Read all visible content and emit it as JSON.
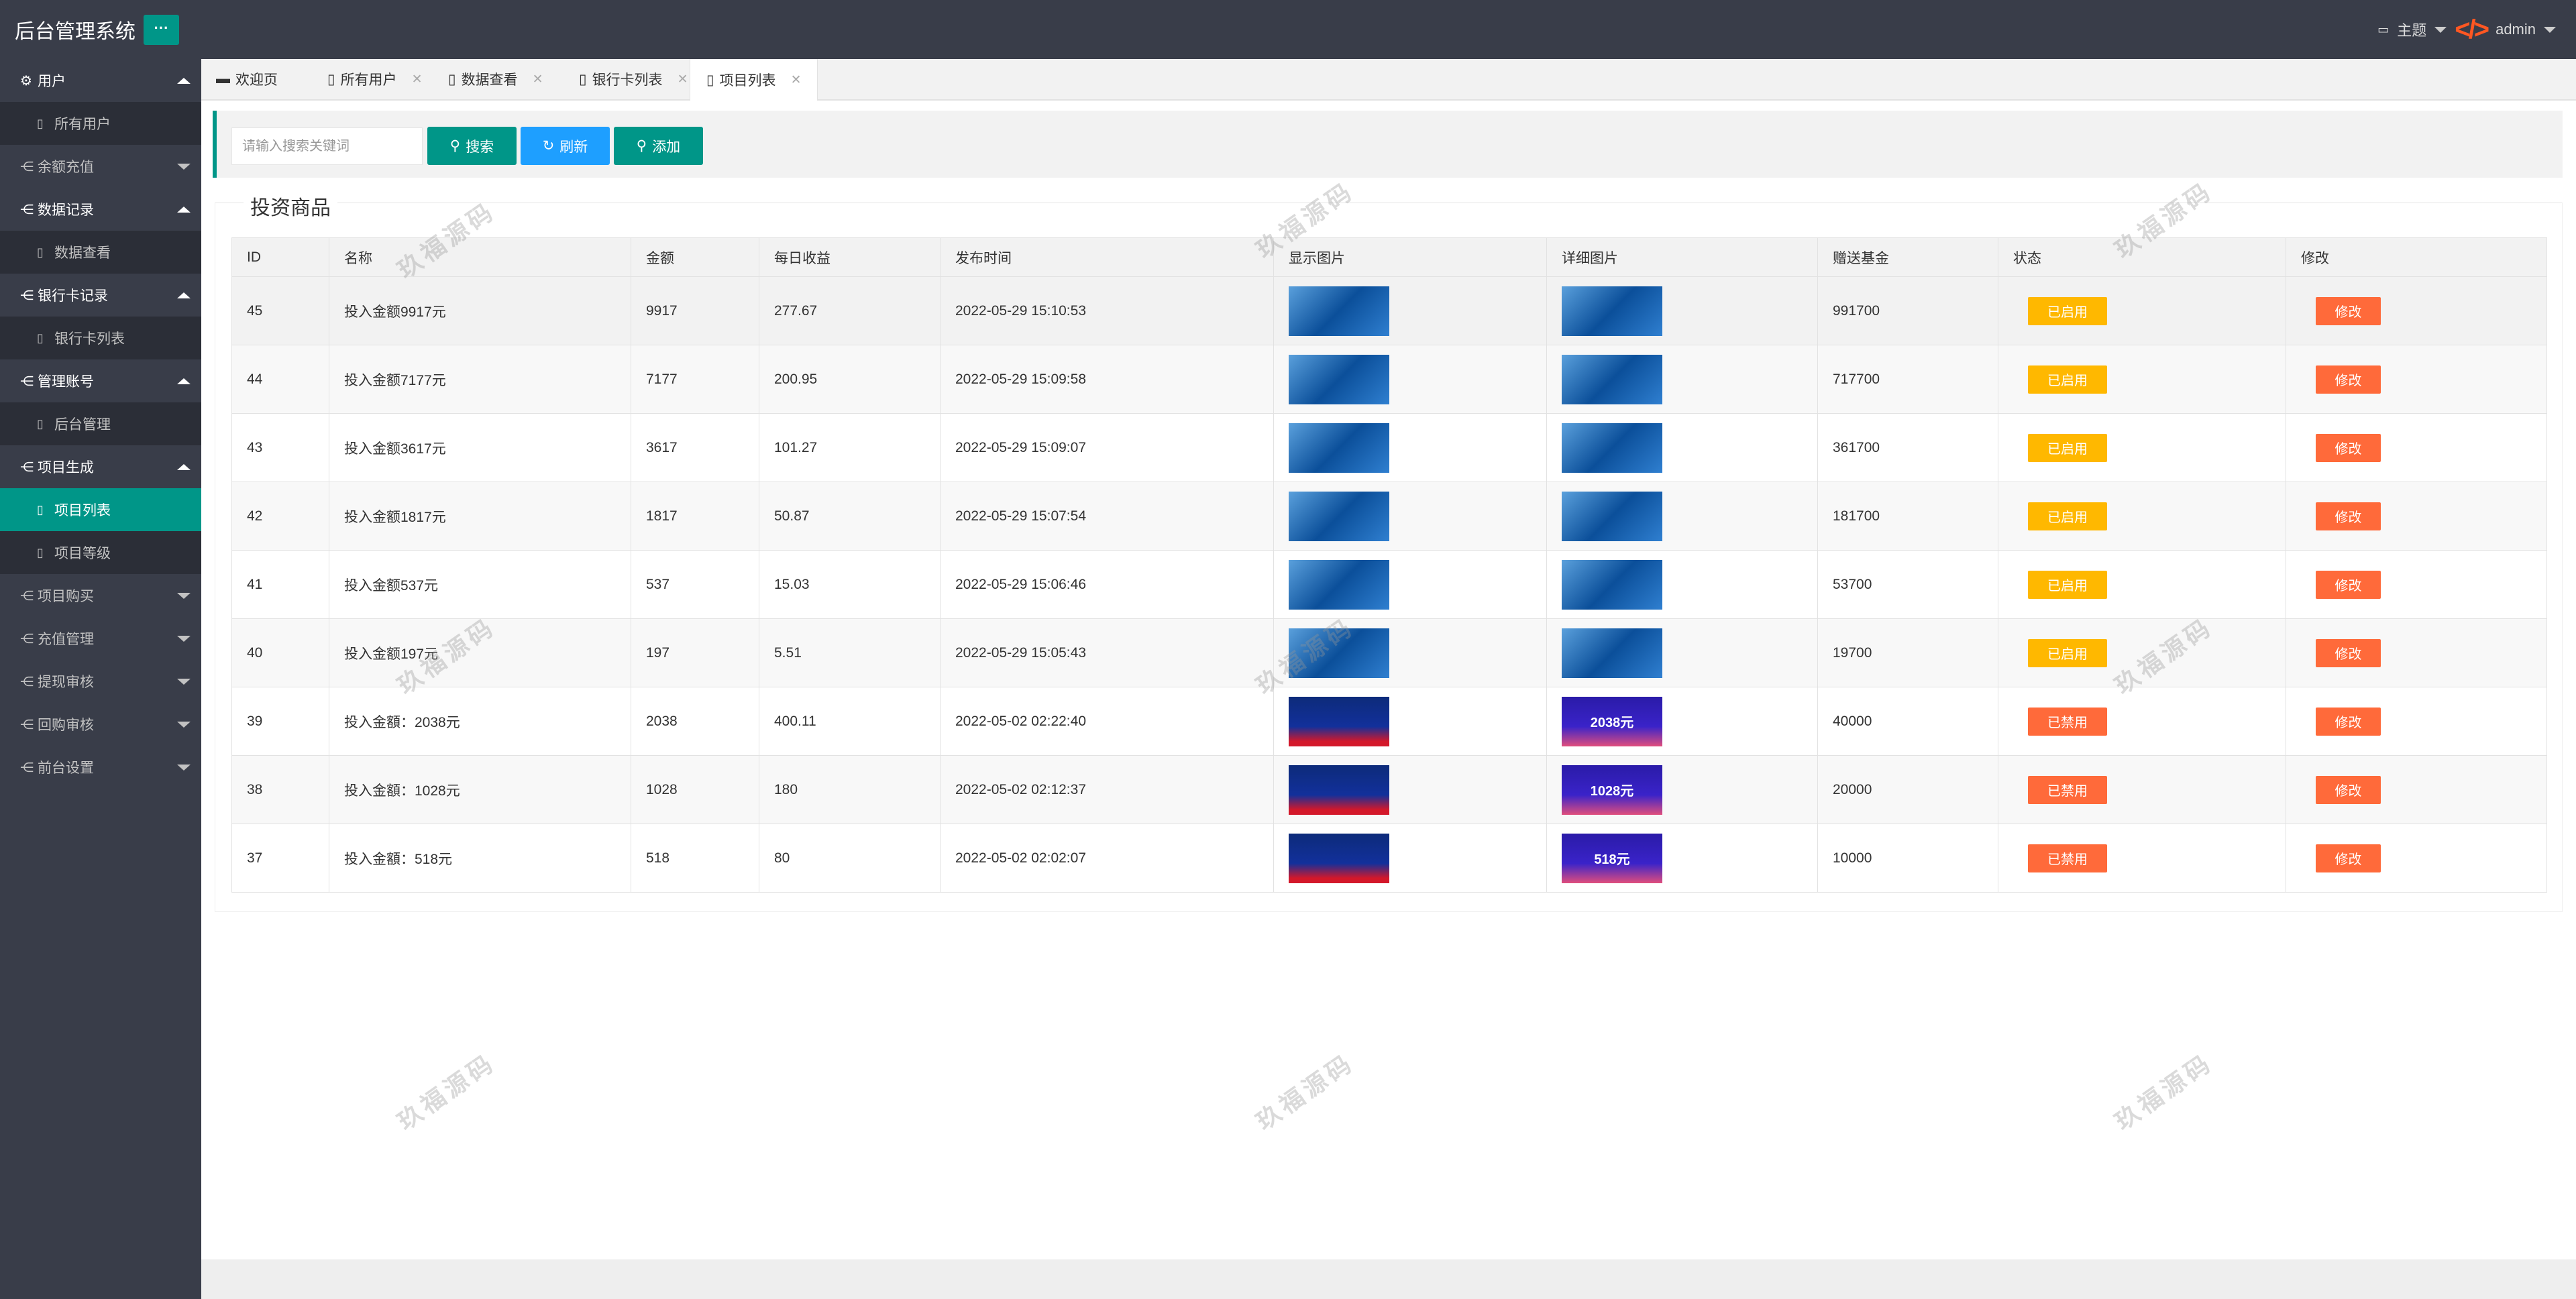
{
  "header": {
    "title": "后台管理系统",
    "menu_toggle": "···",
    "theme_label": "主题",
    "user": "admin",
    "logo_icon": "code-icon"
  },
  "sidebar": [
    {
      "label": "用户",
      "icon": "gear-icon",
      "open": true,
      "children": [
        {
          "label": "所有用户"
        }
      ]
    },
    {
      "label": "余额充值",
      "open": false
    },
    {
      "label": "数据记录",
      "open": true,
      "children": [
        {
          "label": "数据查看"
        }
      ]
    },
    {
      "label": "银行卡记录",
      "open": true,
      "children": [
        {
          "label": "银行卡列表"
        }
      ]
    },
    {
      "label": "管理账号",
      "open": true,
      "children": [
        {
          "label": "后台管理"
        }
      ]
    },
    {
      "label": "项目生成",
      "open": true,
      "children": [
        {
          "label": "项目列表",
          "active": true
        },
        {
          "label": "项目等级"
        }
      ]
    },
    {
      "label": "项目购买",
      "open": false
    },
    {
      "label": "充值管理",
      "open": false
    },
    {
      "label": "提现审核",
      "open": false
    },
    {
      "label": "回购审核",
      "open": false
    },
    {
      "label": "前台设置",
      "open": false
    }
  ],
  "tabs": [
    {
      "label": "欢迎页",
      "closable": false
    },
    {
      "label": "所有用户",
      "closable": true
    },
    {
      "label": "数据查看",
      "closable": true
    },
    {
      "label": "银行卡列表",
      "closable": true
    },
    {
      "label": "项目列表",
      "closable": true,
      "active": true
    }
  ],
  "toolbar": {
    "search_placeholder": "请输入搜索关键词",
    "search": "搜索",
    "refresh": "刷新",
    "add": "添加"
  },
  "section_title": "投资商品",
  "table": {
    "columns": [
      "ID",
      "名称",
      "金额",
      "每日收益",
      "发布时间",
      "显示图片",
      "详细图片",
      "赠送基金",
      "状态",
      "修改"
    ],
    "rows": [
      {
        "id": "45",
        "name": "投入金额9917元",
        "amount": "9917",
        "daily": "277.67",
        "time": "2022-05-29 15:10:53",
        "fund": "991700",
        "status": "已启用",
        "edit": "修改",
        "img": "blue"
      },
      {
        "id": "44",
        "name": "投入金额7177元",
        "amount": "7177",
        "daily": "200.95",
        "time": "2022-05-29 15:09:58",
        "fund": "717700",
        "status": "已启用",
        "edit": "修改",
        "img": "blue"
      },
      {
        "id": "43",
        "name": "投入金额3617元",
        "amount": "3617",
        "daily": "101.27",
        "time": "2022-05-29 15:09:07",
        "fund": "361700",
        "status": "已启用",
        "edit": "修改",
        "img": "blue"
      },
      {
        "id": "42",
        "name": "投入金额1817元",
        "amount": "1817",
        "daily": "50.87",
        "time": "2022-05-29 15:07:54",
        "fund": "181700",
        "status": "已启用",
        "edit": "修改",
        "img": "blue"
      },
      {
        "id": "41",
        "name": "投入金额537元",
        "amount": "537",
        "daily": "15.03",
        "time": "2022-05-29 15:06:46",
        "fund": "53700",
        "status": "已启用",
        "edit": "修改",
        "img": "blue"
      },
      {
        "id": "40",
        "name": "投入金额197元",
        "amount": "197",
        "daily": "5.51",
        "time": "2022-05-29 15:05:43",
        "fund": "19700",
        "status": "已启用",
        "edit": "修改",
        "img": "blue"
      },
      {
        "id": "39",
        "name": "投入金額：2038元",
        "amount": "2038",
        "daily": "400.11",
        "time": "2022-05-02 02:22:40",
        "fund": "40000",
        "status": "已禁用",
        "edit": "修改",
        "img": "red",
        "detail_text": "2038元"
      },
      {
        "id": "38",
        "name": "投入金額：1028元",
        "amount": "1028",
        "daily": "180",
        "time": "2022-05-02 02:12:37",
        "fund": "20000",
        "status": "已禁用",
        "edit": "修改",
        "img": "red",
        "detail_text": "1028元"
      },
      {
        "id": "37",
        "name": "投入金額：518元",
        "amount": "518",
        "daily": "80",
        "time": "2022-05-02 02:02:07",
        "fund": "10000",
        "status": "已禁用",
        "edit": "修改",
        "img": "red",
        "detail_text": "518元"
      }
    ]
  },
  "colors": {
    "accent": "#009688",
    "refresh": "#1e9fff",
    "enabled": "#ffb800",
    "disabled": "#ff6a3a",
    "edit": "#ff6a3a",
    "header_bg": "#393d49"
  },
  "watermark": "玖福源码"
}
